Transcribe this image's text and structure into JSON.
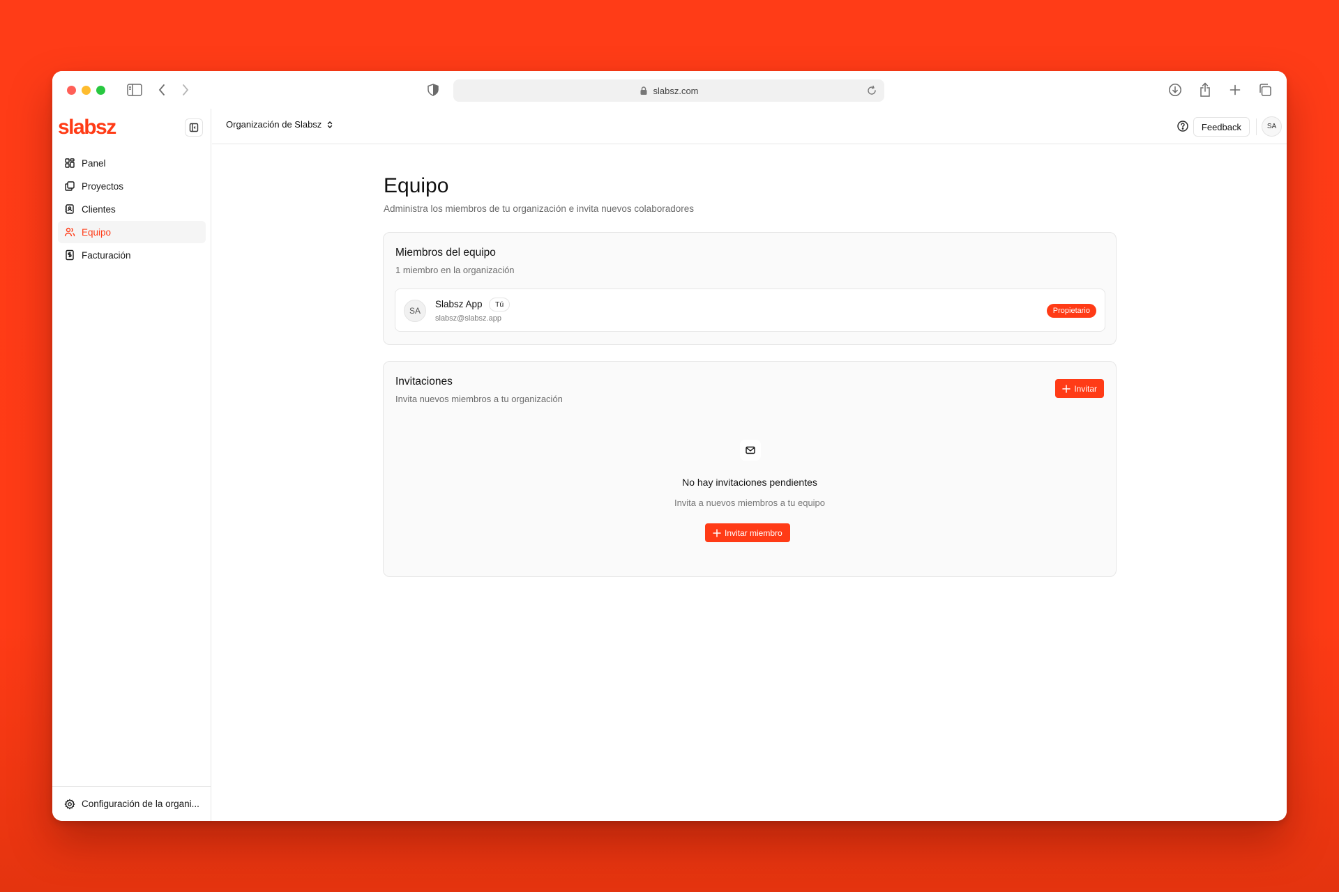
{
  "browser": {
    "url": "slabsz.com"
  },
  "app": {
    "logo": "slabsz",
    "colors": {
      "accent": "#ff3b16",
      "background": "#ff3c17"
    }
  },
  "sidebar": {
    "items": [
      {
        "label": "Panel",
        "icon": "dashboard-icon",
        "active": false
      },
      {
        "label": "Proyectos",
        "icon": "projects-icon",
        "active": false
      },
      {
        "label": "Clientes",
        "icon": "clients-icon",
        "active": false
      },
      {
        "label": "Equipo",
        "icon": "users-icon",
        "active": true
      },
      {
        "label": "Facturación",
        "icon": "billing-icon",
        "active": false
      }
    ],
    "footer_label": "Configuración de la organi..."
  },
  "topbar": {
    "org_name": "Organización de Slabsz",
    "feedback_label": "Feedback",
    "avatar_initials": "SA"
  },
  "page": {
    "title": "Equipo",
    "subtitle": "Administra los miembros de tu organización e invita nuevos colaboradores"
  },
  "members_card": {
    "title": "Miembros del equipo",
    "subtitle": "1 miembro en la organización",
    "members": [
      {
        "initials": "SA",
        "name": "Slabsz App",
        "you_label": "Tú",
        "email": "slabsz@slabsz.app",
        "role": "Propietario"
      }
    ]
  },
  "invites_card": {
    "title": "Invitaciones",
    "subtitle": "Invita nuevos miembros a tu organización",
    "invite_button": "Invitar",
    "empty_title": "No hay invitaciones pendientes",
    "empty_subtitle": "Invita a nuevos miembros a tu equipo",
    "invite_member_button": "Invitar miembro"
  }
}
